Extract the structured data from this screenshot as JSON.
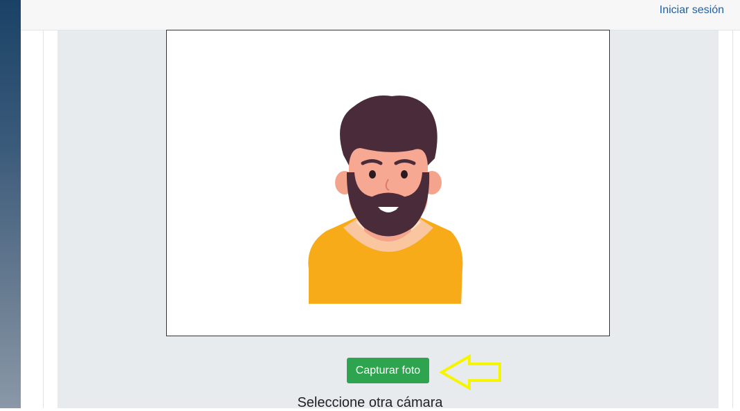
{
  "header": {
    "login_link": "Iniciar sesión"
  },
  "camera": {
    "capture_button": "Capturar foto",
    "select_camera_label": "Seleccione otra cámara"
  },
  "colors": {
    "accent_green": "#2ea44f",
    "arrow_yellow": "#f5f500",
    "link_blue": "#1f5fa8"
  },
  "icons": {
    "avatar": "bearded-man-avatar",
    "arrow": "left-arrow-outline-icon"
  }
}
